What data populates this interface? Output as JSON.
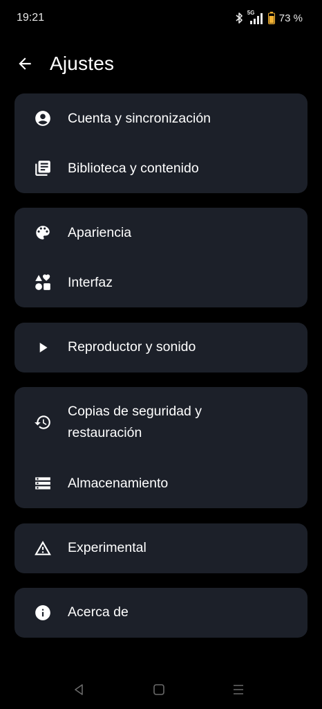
{
  "status_bar": {
    "time": "19:21",
    "network": "5G",
    "battery": "73 %"
  },
  "header": {
    "title": "Ajustes",
    "back_icon": "arrow-left-icon"
  },
  "groups": [
    {
      "items": [
        {
          "label": "Cuenta y sincronización",
          "icon": "account-circle-icon"
        },
        {
          "label": "Biblioteca y contenido",
          "icon": "library-books-icon"
        }
      ]
    },
    {
      "items": [
        {
          "label": "Apariencia",
          "icon": "palette-icon"
        },
        {
          "label": "Interfaz",
          "icon": "shapes-icon"
        }
      ]
    },
    {
      "items": [
        {
          "label": "Reproductor y sonido",
          "icon": "play-icon"
        }
      ]
    },
    {
      "items": [
        {
          "label": "Copias de seguridad y restauración",
          "icon": "history-icon"
        },
        {
          "label": "Almacenamiento",
          "icon": "storage-icon"
        }
      ]
    },
    {
      "items": [
        {
          "label": "Experimental",
          "icon": "warning-icon"
        }
      ]
    },
    {
      "items": [
        {
          "label": "Acerca de",
          "icon": "info-icon"
        }
      ]
    }
  ],
  "colors": {
    "background": "#000000",
    "card": "#1c2029",
    "text": "#ffffff",
    "battery": "#f2b233"
  }
}
